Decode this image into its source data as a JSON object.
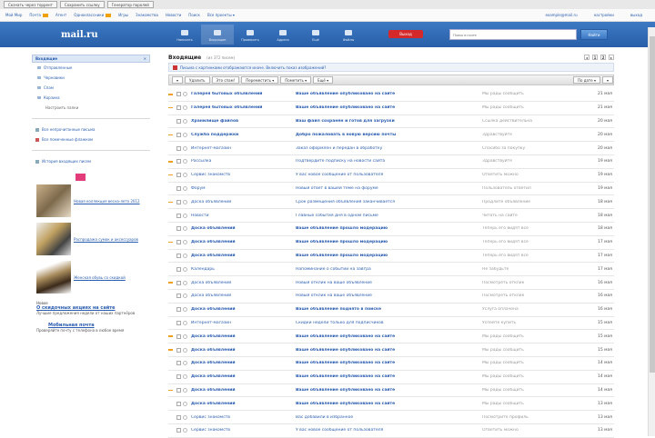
{
  "browser_tabs": [
    "Скачать через торрент",
    "Сохранить ссылку",
    "Генератор паролей"
  ],
  "portal": {
    "links": [
      "Мой Мир",
      "Почта",
      "Агент",
      "Одноклассники",
      "Игры",
      "Знакомства",
      "Новости",
      "Поиск",
      "Все проекты ▾"
    ],
    "new_link_indices": [
      1,
      3
    ],
    "user_email": "example@mail.ru",
    "settings": "настройки",
    "logout": "выход"
  },
  "header": {
    "logo": "mail.ru",
    "nav": [
      "Написать",
      "Входящие",
      "Проверить",
      "Адреса",
      "Ещё",
      "Файлы"
    ],
    "active_nav": 1,
    "exit_label": "Выход",
    "search_placeholder": "Поиск в почте",
    "search_button": "Найти"
  },
  "sidebar": {
    "title": "Входящие",
    "close": "✕",
    "folders": [
      "Отправленные",
      "Черновики",
      "Спам",
      "Корзина"
    ],
    "setup": "Настроить папки",
    "services": [
      "Все непрочитанные письма",
      "Все помеченные флажком"
    ],
    "history": "История входящих писем",
    "ads": [
      "Новая коллекция весна-лето 2012",
      "Распродажа сумок и аксессуаров",
      "Женская обувь со скидкой"
    ],
    "news_label": "Новое",
    "news_link": "О скидочных акциях на сайте",
    "news_text": "Лучшие предложения недели от наших партнёров",
    "promo_title": "Мобильная почта",
    "promo_text": "Проверяйте почту с телефона в любое время"
  },
  "main": {
    "title": "Входящие",
    "subtitle": "(из 372 писем)",
    "pager": [
      "◂",
      "1",
      "2",
      "▸"
    ],
    "notice": "Письма с картинками отображаются иначе. Включить показ изображений?",
    "toolbar": [
      "▾",
      "Удалить",
      "Это спам!",
      "Переместить ▾",
      "Пометить ▾",
      "Ещё ▾"
    ],
    "toolbar_right": [
      "По дате ▾",
      "▾"
    ],
    "messages": [
      {
        "from": "Галерея бытовых объявлений",
        "subject": "Ваше объявление опубликовано на сайте",
        "snippet": "Мы рады сообщить",
        "date": "21 мая",
        "unread": true,
        "flag": true
      },
      {
        "from": "Галерея бытовых объявлений",
        "subject": "Ваше объявление опубликовано на сайте",
        "snippet": "Мы рады сообщить",
        "date": "21 мая",
        "unread": true,
        "flag": true
      },
      {
        "from": "Хранилище файлов",
        "subject": "Ваш файл сохранён и готов для загрузки",
        "snippet": "Ссылка действительна",
        "date": "20 мая",
        "unread": true,
        "flag": false
      },
      {
        "from": "Служба поддержки",
        "subject": "Добро пожаловать в новую версию почты",
        "snippet": "Здравствуйте",
        "date": "20 мая",
        "unread": true,
        "flag": true
      },
      {
        "from": "Интернет-магазин",
        "subject": "Заказ оформлен и передан в обработку",
        "snippet": "Спасибо за покупку",
        "date": "20 мая",
        "unread": false,
        "flag": false
      },
      {
        "from": "Рассылка",
        "subject": "Подтвердите подписку на новости сайта",
        "snippet": "Здравствуйте",
        "date": "19 мая",
        "unread": false,
        "flag": true
      },
      {
        "from": "Сервис знакомств",
        "subject": "У вас новое сообщение от пользователя",
        "snippet": "Ответить можно",
        "date": "19 мая",
        "unread": false,
        "flag": true
      },
      {
        "from": "Форум",
        "subject": "Новый ответ в вашей теме на форуме",
        "snippet": "Пользователь ответил",
        "date": "19 мая",
        "unread": false,
        "flag": false
      },
      {
        "from": "Доска объявлений",
        "subject": "Срок размещения объявления заканчивается",
        "snippet": "Продлите объявление",
        "date": "18 мая",
        "unread": false,
        "flag": true
      },
      {
        "from": "Новости",
        "subject": "Главные события дня в одном письме",
        "snippet": "Читать на сайте",
        "date": "18 мая",
        "unread": false,
        "flag": false
      },
      {
        "from": "Доска объявлений",
        "subject": "Ваше объявление прошло модерацию",
        "snippet": "Теперь его видят все",
        "date": "18 мая",
        "unread": true,
        "flag": false
      },
      {
        "from": "Доска объявлений",
        "subject": "Ваше объявление прошло модерацию",
        "snippet": "Теперь его видят все",
        "date": "17 мая",
        "unread": true,
        "flag": true
      },
      {
        "from": "Доска объявлений",
        "subject": "Ваше объявление прошло модерацию",
        "snippet": "Теперь его видят все",
        "date": "17 мая",
        "unread": true,
        "flag": false
      },
      {
        "from": "Календарь",
        "subject": "Напоминание о событии на завтра",
        "snippet": "Не забудьте",
        "date": "17 мая",
        "unread": false,
        "flag": false
      },
      {
        "from": "Доска объявлений",
        "subject": "Новый отклик на ваше объявление",
        "snippet": "Посмотреть отклик",
        "date": "16 мая",
        "unread": false,
        "flag": true
      },
      {
        "from": "Доска объявлений",
        "subject": "Новый отклик на ваше объявление",
        "snippet": "Посмотреть отклик",
        "date": "16 мая",
        "unread": false,
        "flag": false
      },
      {
        "from": "Доска объявлений",
        "subject": "Ваше объявление поднято в поиске",
        "snippet": "Услуга оплачена",
        "date": "16 мая",
        "unread": true,
        "flag": false
      },
      {
        "from": "Интернет-магазин",
        "subject": "Скидки недели только для подписчиков",
        "snippet": "Успейте купить",
        "date": "15 мая",
        "unread": false,
        "flag": false
      },
      {
        "from": "Доска объявлений",
        "subject": "Ваше объявление опубликовано на сайте",
        "snippet": "Мы рады сообщить",
        "date": "15 мая",
        "unread": true,
        "flag": true
      },
      {
        "from": "Доска объявлений",
        "subject": "Ваше объявление опубликовано на сайте",
        "snippet": "Мы рады сообщить",
        "date": "15 мая",
        "unread": true,
        "flag": true
      },
      {
        "from": "Доска объявлений",
        "subject": "Ваше объявление опубликовано на сайте",
        "snippet": "Мы рады сообщить",
        "date": "14 мая",
        "unread": true,
        "flag": false
      },
      {
        "from": "Доска объявлений",
        "subject": "Ваше объявление опубликовано на сайте",
        "snippet": "Мы рады сообщить",
        "date": "14 мая",
        "unread": true,
        "flag": false
      },
      {
        "from": "Доска объявлений",
        "subject": "Ваше объявление опубликовано на сайте",
        "snippet": "Мы рады сообщить",
        "date": "14 мая",
        "unread": true,
        "flag": true
      },
      {
        "from": "Доска объявлений",
        "subject": "Ваше объявление опубликовано на сайте",
        "snippet": "Мы рады сообщить",
        "date": "13 мая",
        "unread": true,
        "flag": false
      },
      {
        "from": "Сервис знакомств",
        "subject": "Вас добавили в избранное",
        "snippet": "Посмотрите профиль",
        "date": "13 мая",
        "unread": false,
        "flag": false
      },
      {
        "from": "Сервис знакомств",
        "subject": "У вас новое сообщение от пользователя",
        "snippet": "Ответить можно",
        "date": "13 мая",
        "unread": false,
        "flag": false
      }
    ]
  }
}
